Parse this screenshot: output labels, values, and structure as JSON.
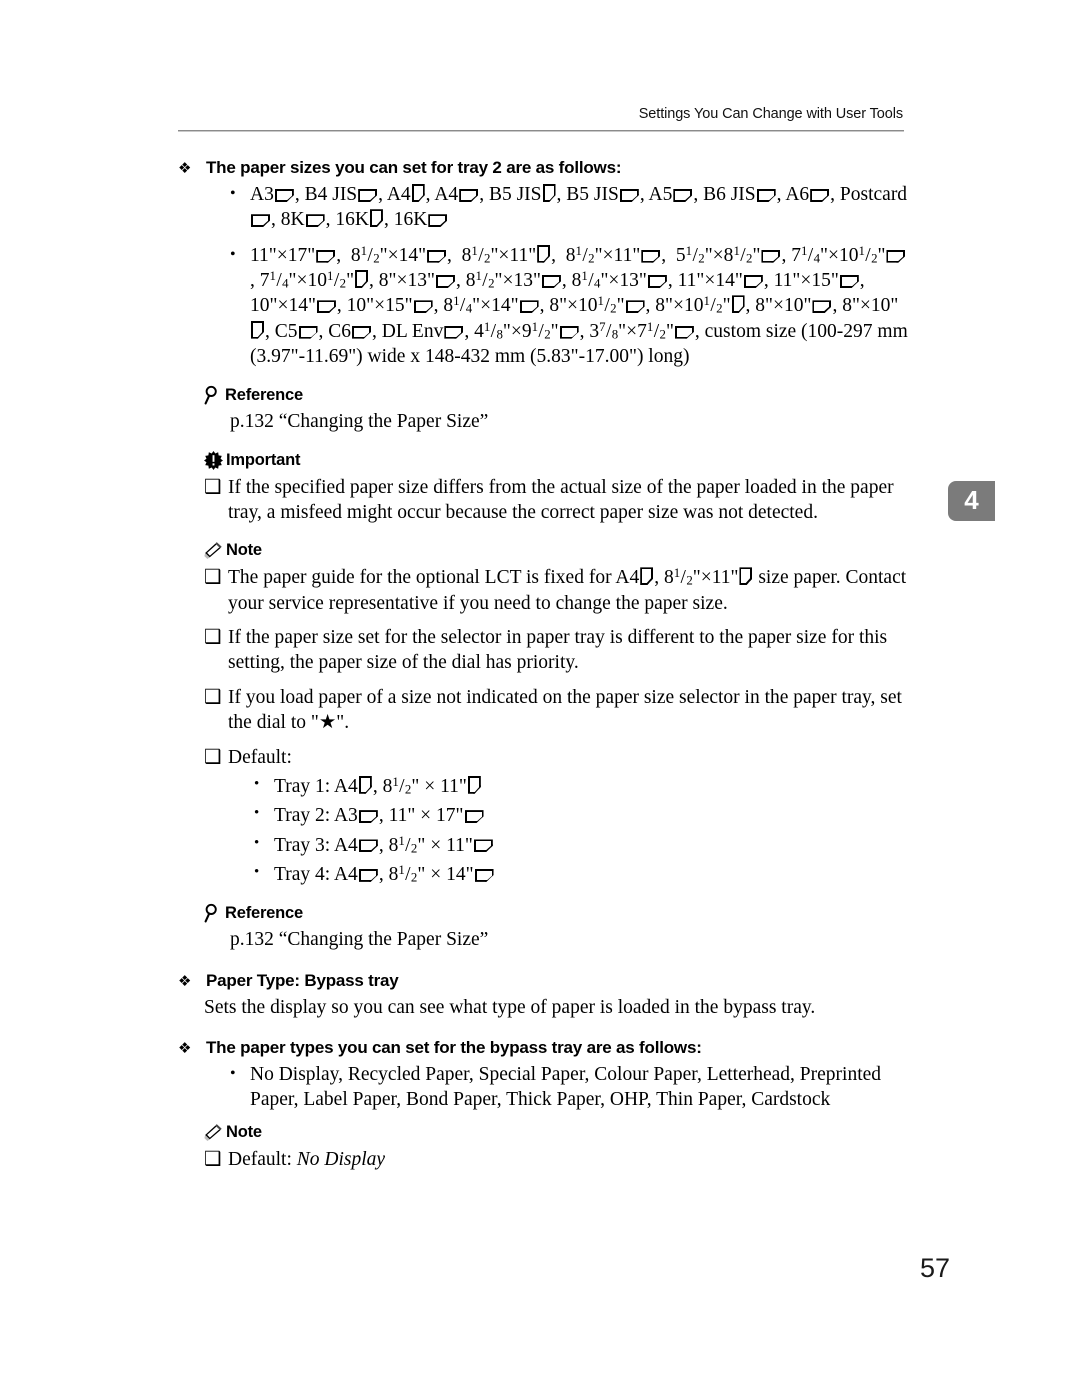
{
  "page": {
    "running_header": "Settings You Can Change with User Tools",
    "chapter_tab": "4",
    "folio": "57"
  },
  "icons": {
    "reference": "magnifier-icon",
    "important": "starburst-exclamation-icon",
    "note": "pencil-icon",
    "section_bullet": "❖",
    "round_bullet": "•",
    "square_bullet": "❑",
    "paper_landscape": "paper-landscape-icon",
    "paper_portrait": "paper-portrait-icon"
  },
  "sections": {
    "tray2_sizes": {
      "heading": "The paper sizes you can set for tray 2 are as follows:",
      "metric_line_1": "A3▭, B4 JIS▭, A4▯, A4▭, B5 JIS▯, B5 JIS▭, A5▭, B6 JIS▭, A6▭,",
      "metric_line_2": "Postcard▭, 8K▭, 16K▯, 16K▭",
      "imperial_line_1": "11\"×17\"▭,  8 1/2\"×14\"▭,  8 1/2\"×11\"▯,  8 1/2\"×11\"▭,  5 1/2\"×8 1/2\"▭,",
      "imperial_line_2": "7 1/4\"×10 1/2\"▭, 7 1/4\"×10 1/2\"▯, 8\"×13\"▭, 8 1/2\"×13\"▭, 8 1/4\"×13\"▭,",
      "imperial_line_3": "11\"×14\"▭, 11\"×15\"▭, 10\"×14\"▭, 10\"×15\"▭, 8 1/4\"×14\"▭, 8\"×10 1/2\"▭,",
      "imperial_line_4": "8\"×10 1/2\"▯, 8\"×10\"▭, 8\"×10\"▯, C5▭, C6▭, DL Env▭, 4 1/8\"×9 1/2\"▭,",
      "imperial_line_5": "3 7/8\"×7 1/2\"▭, custom size (100-297 mm (3.97\"-11.69\") wide x 148-432",
      "imperial_line_6": "mm (5.83\"-17.00\") long)"
    },
    "reference_1": {
      "label": "Reference",
      "body": "p.132 “Changing the Paper Size”"
    },
    "important": {
      "label": "Important",
      "items": [
        "If the specified paper size differs from the actual size of the paper loaded in the paper tray, a misfeed might occur because the correct paper size was not detected."
      ]
    },
    "note_1": {
      "label": "Note",
      "item_1_part_a": "The paper guide for the optional LCT is fixed for A4",
      "item_1_part_b": ", 8",
      "item_1_frac_num": "1",
      "item_1_frac_den": "2",
      "item_1_part_c": "\"×11\"",
      "item_1_part_d": " size paper. Contact your service representative if you need to change the paper size.",
      "item_2": "If the paper size set for the selector in paper tray is different to the paper size for this setting, the paper size of the dial has priority.",
      "item_3": "If you load paper of a size not indicated on the paper size selector in the paper tray, set the dial to \"★\".",
      "item_4": "Default:",
      "defaults": [
        {
          "tray": "Tray 1: A4",
          "orient1": "portrait",
          "size": "8 1/2\" × 11\"",
          "orient2": "portrait"
        },
        {
          "tray": "Tray 2: A3",
          "orient1": "landscape",
          "size": "11\" × 17\"",
          "orient2": "landscape"
        },
        {
          "tray": "Tray 3: A4",
          "orient1": "landscape",
          "size": "8 1/2\" × 11\"",
          "orient2": "landscape"
        },
        {
          "tray": "Tray 4: A4",
          "orient1": "landscape",
          "size": "8 1/2\" × 14\"",
          "orient2": "landscape"
        }
      ]
    },
    "reference_2": {
      "label": "Reference",
      "body": "p.132 “Changing the Paper Size”"
    },
    "bypass_tray": {
      "heading": "Paper Type: Bypass tray",
      "description": "Sets the display so you can see what type of paper is loaded in the bypass tray."
    },
    "bypass_types": {
      "heading": "The paper types you can set for the bypass tray are as follows:",
      "list": "No Display, Recycled Paper, Special Paper, Colour Paper, Letterhead, Preprinted Paper, Label Paper, Bond Paper, Thick Paper, OHP, Thin Paper, Cardstock"
    },
    "note_2": {
      "label": "Note",
      "default_prefix": "Default: ",
      "default_value": "No Display"
    }
  }
}
